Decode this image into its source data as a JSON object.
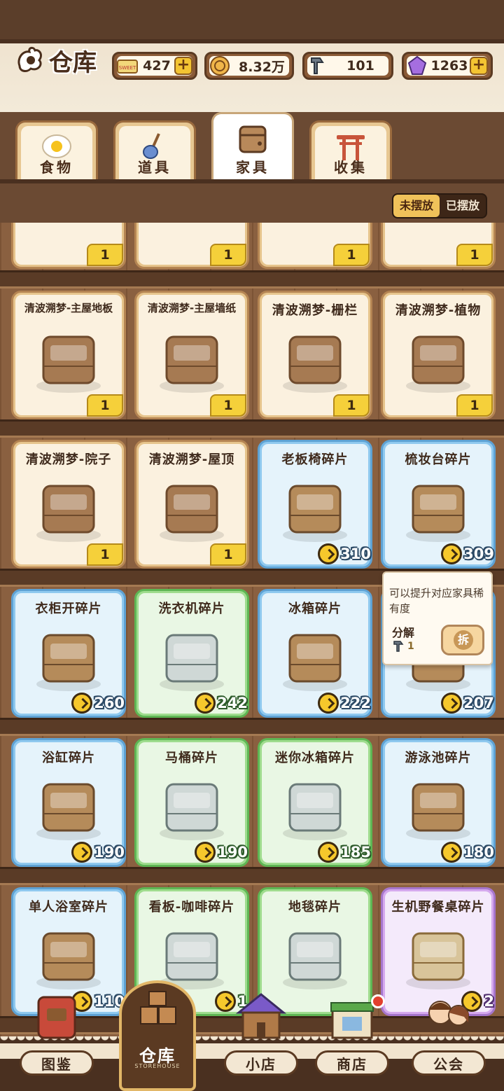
{
  "header": {
    "title": "仓库",
    "resources": [
      {
        "name": "ticket-icon",
        "value": "427",
        "plus": true
      },
      {
        "name": "coin-icon",
        "value": "8.32万",
        "plus": false
      },
      {
        "name": "bolt-icon",
        "value": "101",
        "plus": false
      },
      {
        "name": "gem-icon",
        "value": "1263",
        "plus": true
      }
    ]
  },
  "tabs": [
    {
      "label": "食物",
      "icon": "egg-icon",
      "active": false
    },
    {
      "label": "道具",
      "icon": "shovel-icon",
      "active": false
    },
    {
      "label": "家具",
      "icon": "cabinet-icon",
      "active": true
    },
    {
      "label": "收集",
      "icon": "torii-icon",
      "active": false
    }
  ],
  "filter": {
    "option_a": "未摆放",
    "option_b": "已摆放",
    "selected": "未摆放"
  },
  "row0_counts": [
    "1",
    "1",
    "1",
    "1"
  ],
  "cards": [
    {
      "name": "清波溯梦-主屋地板",
      "rarity": "beige",
      "count": "1",
      "icon": "floor-icon"
    },
    {
      "name": "清波溯梦-主屋墙纸",
      "rarity": "beige",
      "count": "1",
      "icon": "wallpaper-icon"
    },
    {
      "name": "清波溯梦-栅栏",
      "rarity": "beige",
      "count": "1",
      "icon": "fence-icon"
    },
    {
      "name": "清波溯梦-植物",
      "rarity": "beige",
      "count": "1",
      "icon": "tree-icon"
    },
    {
      "name": "清波溯梦-院子",
      "rarity": "beige",
      "count": "1",
      "icon": "yard-icon"
    },
    {
      "name": "清波溯梦-屋顶",
      "rarity": "beige",
      "count": "1",
      "icon": "roof-icon"
    },
    {
      "name": "老板椅碎片",
      "rarity": "blue",
      "count": "310",
      "icon": "office-chair-icon"
    },
    {
      "name": "梳妆台碎片",
      "rarity": "blue",
      "count": "309",
      "icon": "dresser-icon"
    },
    {
      "name": "衣柜开碎片",
      "rarity": "blue",
      "count": "260",
      "icon": "wardrobe-icon"
    },
    {
      "name": "洗衣机碎片",
      "rarity": "green",
      "count": "242",
      "icon": "washing-machine-icon"
    },
    {
      "name": "冰箱碎片",
      "rarity": "blue",
      "count": "222",
      "icon": "fridge-icon"
    },
    {
      "name": "",
      "rarity": "blue",
      "count": "207",
      "icon": "drawer-icon"
    },
    {
      "name": "浴缸碎片",
      "rarity": "blue",
      "count": "190",
      "icon": "bathtub-icon"
    },
    {
      "name": "马桶碎片",
      "rarity": "green",
      "count": "190",
      "icon": "toilet-icon"
    },
    {
      "name": "迷你冰箱碎片",
      "rarity": "green",
      "count": "185",
      "icon": "mini-fridge-icon"
    },
    {
      "name": "游泳池碎片",
      "rarity": "blue",
      "count": "180",
      "icon": "pool-icon"
    },
    {
      "name": "单人浴室碎片",
      "rarity": "blue",
      "count": "110",
      "icon": "shower-icon"
    },
    {
      "name": "看板-咖啡碎片",
      "rarity": "green",
      "count": "1",
      "icon": "coffee-sign-icon"
    },
    {
      "name": "地毯碎片",
      "rarity": "green",
      "count": "",
      "icon": "rug-icon"
    },
    {
      "name": "生机野餐桌碎片",
      "rarity": "purple",
      "count": "2",
      "icon": "picnic-table-icon"
    }
  ],
  "tooltip": {
    "text": "可以提升对应家具稀有度",
    "decompose_label": "分解",
    "decompose_value": "1",
    "button_label": "拆"
  },
  "nav": [
    {
      "label": "图鉴",
      "icon": "book-icon"
    },
    {
      "label": "仓库",
      "sub": "STOREHOUSE",
      "icon": "boxes-icon",
      "active": true
    },
    {
      "label": "小店",
      "icon": "shop-house-icon"
    },
    {
      "label": "商店",
      "icon": "store-icon",
      "badge": true
    },
    {
      "label": "公会",
      "icon": "couple-icon"
    }
  ]
}
